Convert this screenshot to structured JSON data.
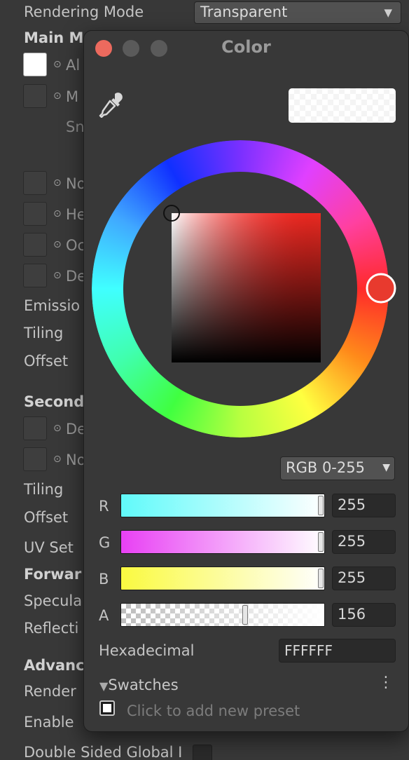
{
  "inspector": {
    "rendering_mode_label": "Rendering Mode",
    "rendering_mode_value": "Transparent",
    "main_maps_label": "Main M",
    "albedo_name": "Al",
    "metallic_name": "M",
    "smoothness_label": "Sn",
    "normal_name": "No",
    "height_name": "He",
    "occlusion_name": "Oc",
    "detail_mask_name": "De",
    "emission_label": "Emissio",
    "tiling_label": "Tiling",
    "offset_label": "Offset",
    "secondary_maps_label": "Second",
    "detail_albedo_name": "De",
    "detail_normal_name": "No",
    "tiling2_label": "Tiling",
    "offset2_label": "Offset",
    "uv_set_label": "UV Set",
    "forward_label": "Forwar",
    "specular_label": "Specula",
    "reflections_label": "Reflecti",
    "advanced_label": "Advanc",
    "render_queue_label": "Render",
    "enable_gpu_label": "Enable",
    "double_sided_label": "Double Sided Global I"
  },
  "color_window": {
    "title": "Color",
    "current_color": "#FFFFFF",
    "alpha": 156,
    "mode": "RGB 0-255",
    "hue_marker_color": "#E83A2E",
    "channels": [
      {
        "label": "R",
        "value": "255"
      },
      {
        "label": "G",
        "value": "255"
      },
      {
        "label": "B",
        "value": "255"
      },
      {
        "label": "A",
        "value": "156"
      }
    ],
    "hex_label": "Hexadecimal",
    "hex_value": "FFFFFF",
    "swatches_label": "Swatches",
    "swatches_collapse_icon": "triangle-down-icon",
    "preset_hint": "Click to add new preset"
  },
  "colors": {
    "close": "#EC6A5E",
    "inactive_traffic": "#5A5A5A",
    "panel_bg": "#383838"
  }
}
